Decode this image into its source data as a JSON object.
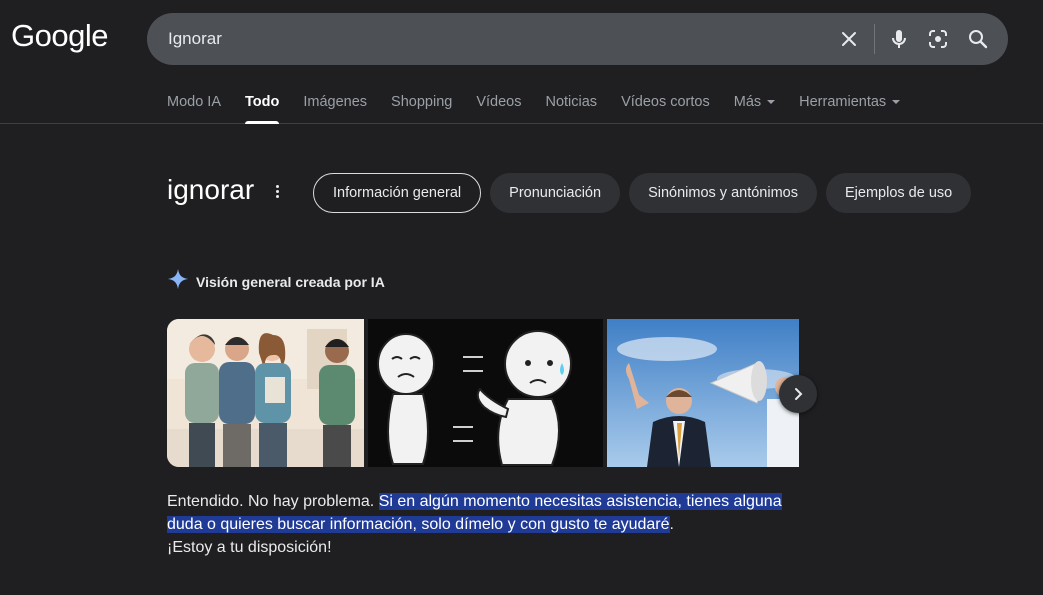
{
  "logo": "Google",
  "search": {
    "query": "Ignorar"
  },
  "icons": [
    "clear-icon",
    "mic-icon",
    "lens-icon",
    "search-icon",
    "sparkle-icon",
    "chevron-right-icon",
    "more-vert-icon"
  ],
  "tabs": [
    {
      "label": "Modo IA"
    },
    {
      "label": "Todo"
    },
    {
      "label": "Imágenes"
    },
    {
      "label": "Shopping"
    },
    {
      "label": "Vídeos"
    },
    {
      "label": "Noticias"
    },
    {
      "label": "Vídeos cortos"
    },
    {
      "label": "Más"
    },
    {
      "label": "Herramientas"
    }
  ],
  "active_tab": "Todo",
  "term": "ignorar",
  "chips": [
    {
      "label": "Información general"
    },
    {
      "label": "Pronunciación"
    },
    {
      "label": "Sinónimos y antónimos"
    },
    {
      "label": "Ejemplos de uso"
    }
  ],
  "ai_overview": {
    "label": "Visión general creada por IA",
    "text_plain_start": "Entendido. No hay problema. ",
    "text_highlight": "Si en algún momento necesitas asistencia, tienes alguna duda o quieres buscar información, solo dímelo y con gusto te ayudaré",
    "text_plain_end": ".",
    "text_last_line": "¡Estoy a tu disposición!"
  },
  "colors": {
    "background": "#1f1f21",
    "highlight": "#203b96",
    "chip": "#303134",
    "searchbox": "#4d5156",
    "gemini_blue": "#8ab4f8"
  }
}
